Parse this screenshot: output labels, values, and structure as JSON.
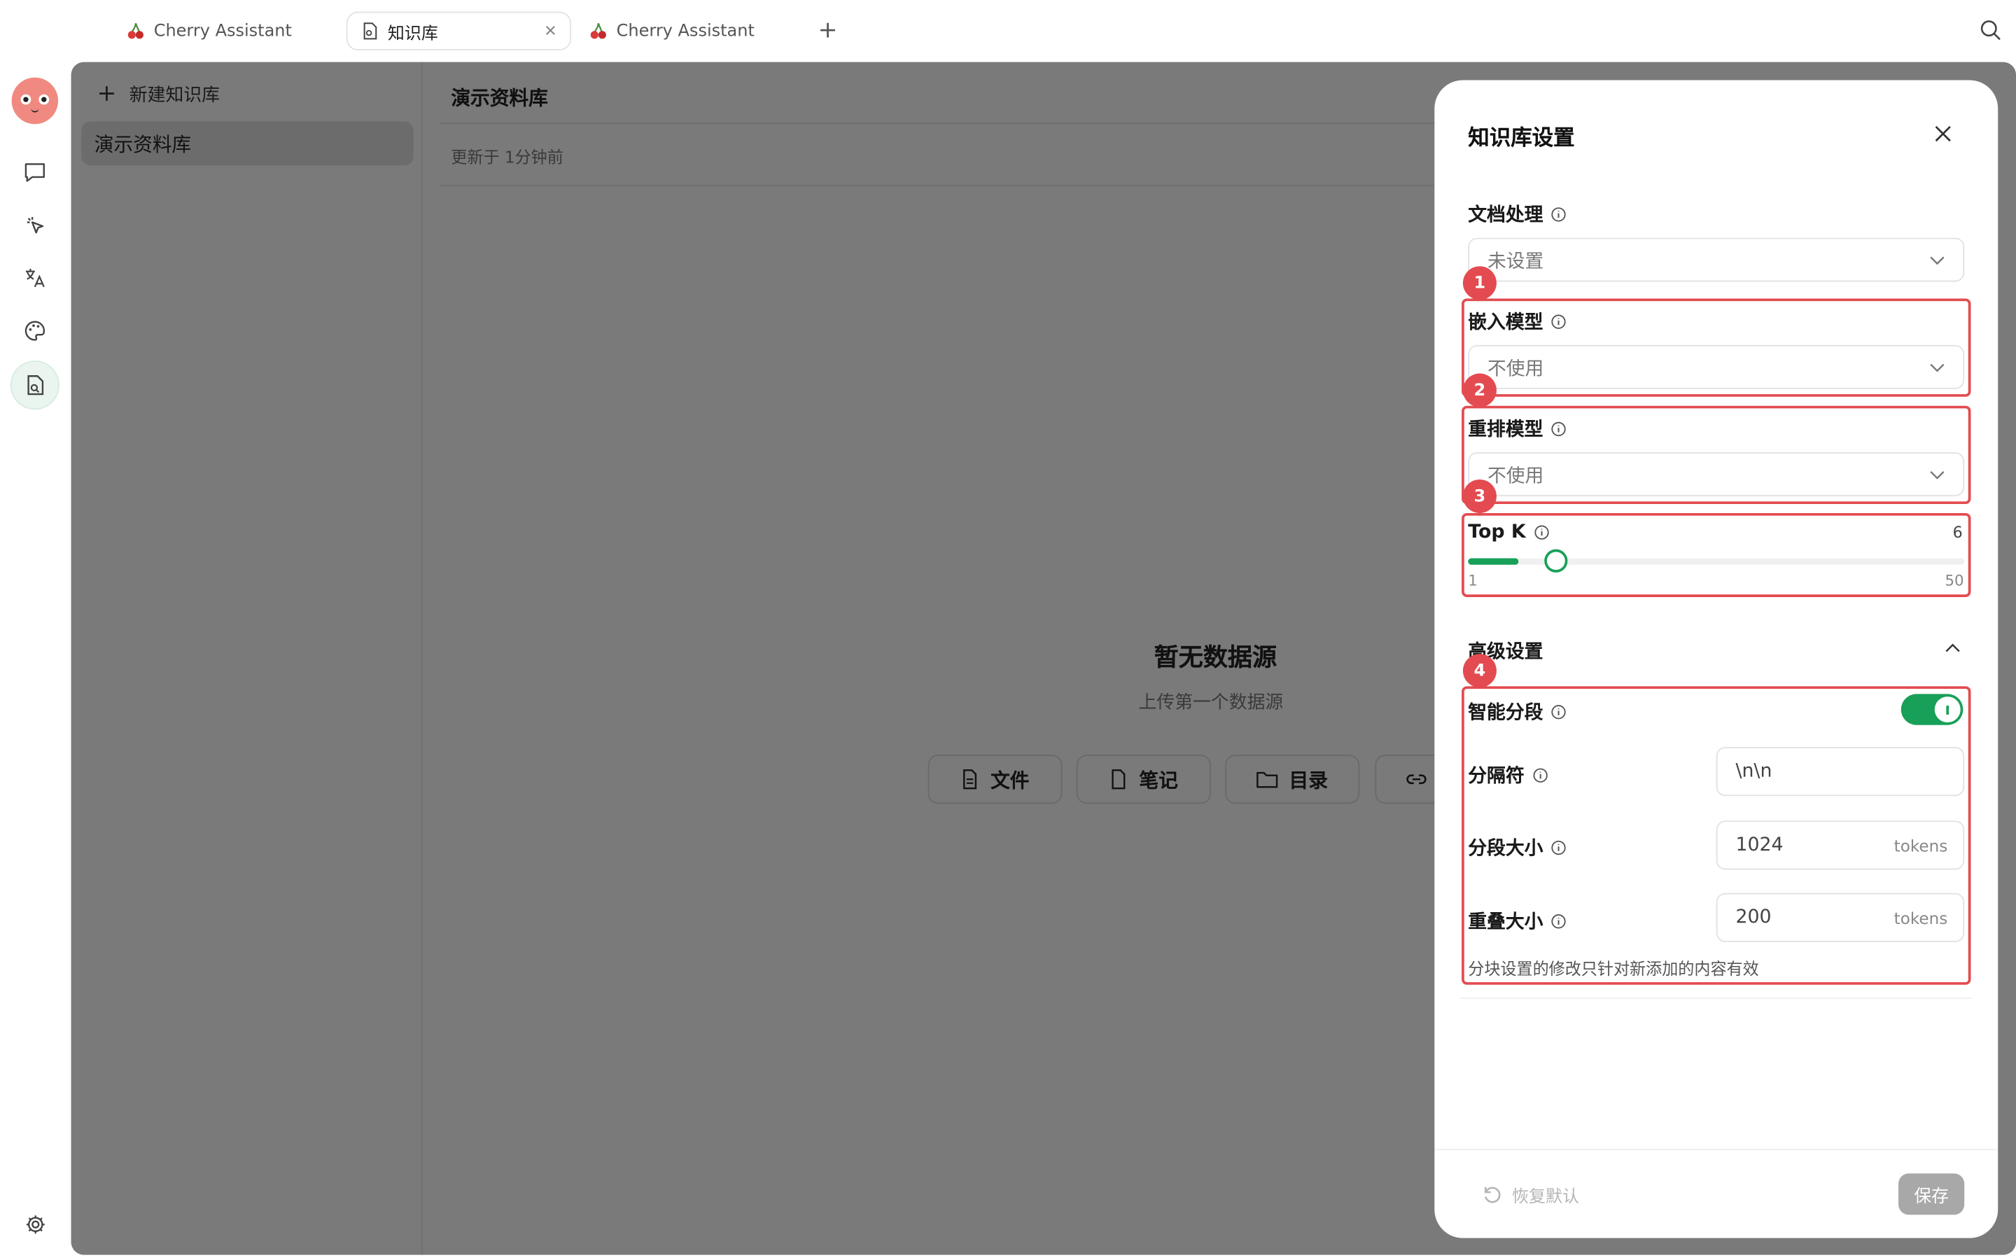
{
  "tabs": [
    {
      "label": "Cherry Assistant"
    },
    {
      "label": "知识库"
    },
    {
      "label": "Cherry Assistant"
    }
  ],
  "kb_list": {
    "new_label": "新建知识库",
    "items": [
      "演示资料库"
    ]
  },
  "content": {
    "title": "演示资料库",
    "updated": "更新于 1分钟前",
    "empty_title": "暂无数据源",
    "empty_subtitle": "上传第一个数据源",
    "buttons": [
      "文件",
      "笔记",
      "目录"
    ]
  },
  "drawer": {
    "title": "知识库设置",
    "doc_processing": {
      "label": "文档处理",
      "value": "未设置"
    },
    "embed_model": {
      "label": "嵌入模型",
      "value": "不使用"
    },
    "rerank_model": {
      "label": "重排模型",
      "value": "不使用"
    },
    "topk": {
      "label": "Top K",
      "value": 6,
      "value_label": "6",
      "min": 1,
      "min_label": "1",
      "max": 50,
      "max_label": "50"
    },
    "advanced": {
      "label": "高级设置"
    },
    "smart_chunk": {
      "label": "智能分段",
      "enabled": true
    },
    "separator": {
      "label": "分隔符",
      "value": "\\n\\n"
    },
    "chunk_size": {
      "label": "分段大小",
      "value": "1024",
      "unit": "tokens"
    },
    "overlap": {
      "label": "重叠大小",
      "value": "200",
      "unit": "tokens"
    },
    "note": "分块设置的修改只针对新添加的内容有效",
    "reset_label": "恢复默认",
    "save_label": "保存"
  },
  "annotations": [
    "1",
    "2",
    "3",
    "4"
  ],
  "colors": {
    "accent_green": "#18a058",
    "annotation_red": "#e34b50",
    "overlay": "#7a7a7a"
  }
}
